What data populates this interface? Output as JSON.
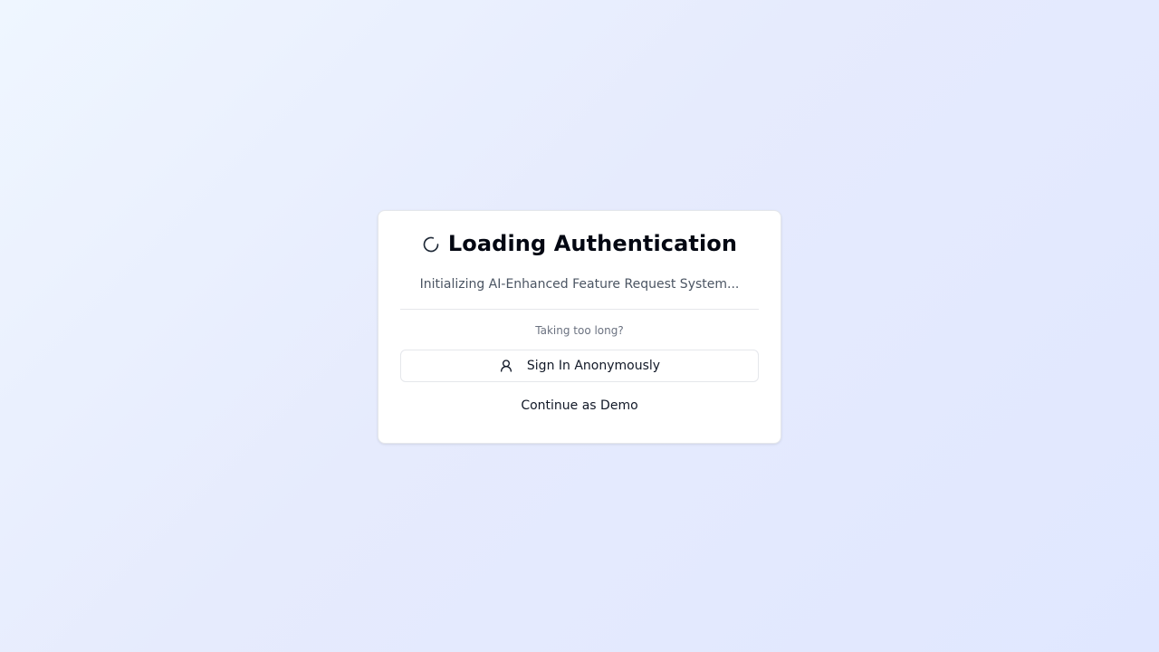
{
  "card": {
    "title": "Loading Authentication",
    "title_icon": "loader-spinner-icon",
    "subtitle": "Initializing AI-Enhanced Feature Request System...",
    "hint": "Taking too long?",
    "anonymous_button": {
      "label": "Sign In Anonymously",
      "icon": "user-icon"
    },
    "demo_button": {
      "label": "Continue as Demo"
    }
  },
  "colors": {
    "background_start": "#eff6ff",
    "background_end": "#e0e7ff",
    "card_background": "#ffffff",
    "title_text": "#030712",
    "muted_text": "#4b5563",
    "border": "#e5e7eb"
  }
}
